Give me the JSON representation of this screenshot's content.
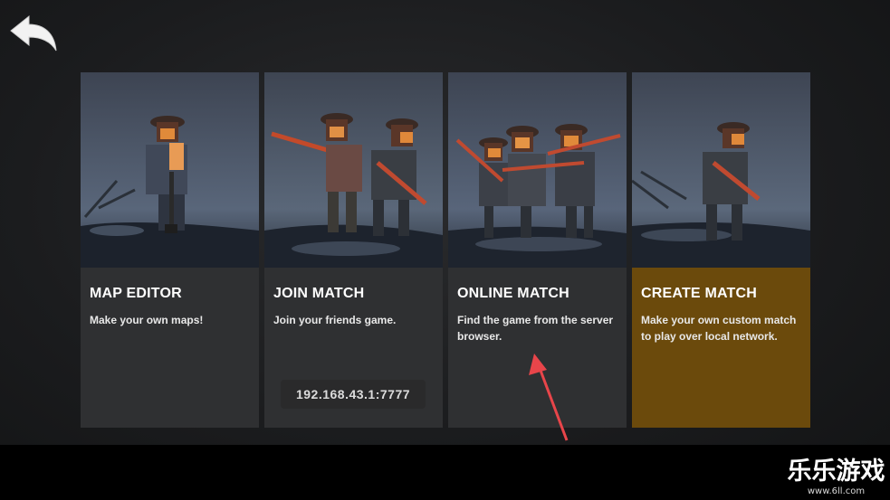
{
  "colors": {
    "card_bg": "#2f3032",
    "card_highlight_bg": "#6b4a0c",
    "annotation_arrow": "#e8454a"
  },
  "back": {
    "icon": "back-arrow-icon"
  },
  "cards": [
    {
      "title": "MAP EDITOR",
      "description": "Make your own maps!"
    },
    {
      "title": "JOIN MATCH",
      "description": "Join your friends game.",
      "ip": "192.168.43.1:7777"
    },
    {
      "title": "ONLINE MATCH",
      "description": "Find the game from the server browser."
    },
    {
      "title": "CREATE MATCH",
      "description": "Make your own custom match to play over local network."
    }
  ],
  "watermark": {
    "title": "乐乐游戏",
    "url": "www.6ll.com"
  }
}
